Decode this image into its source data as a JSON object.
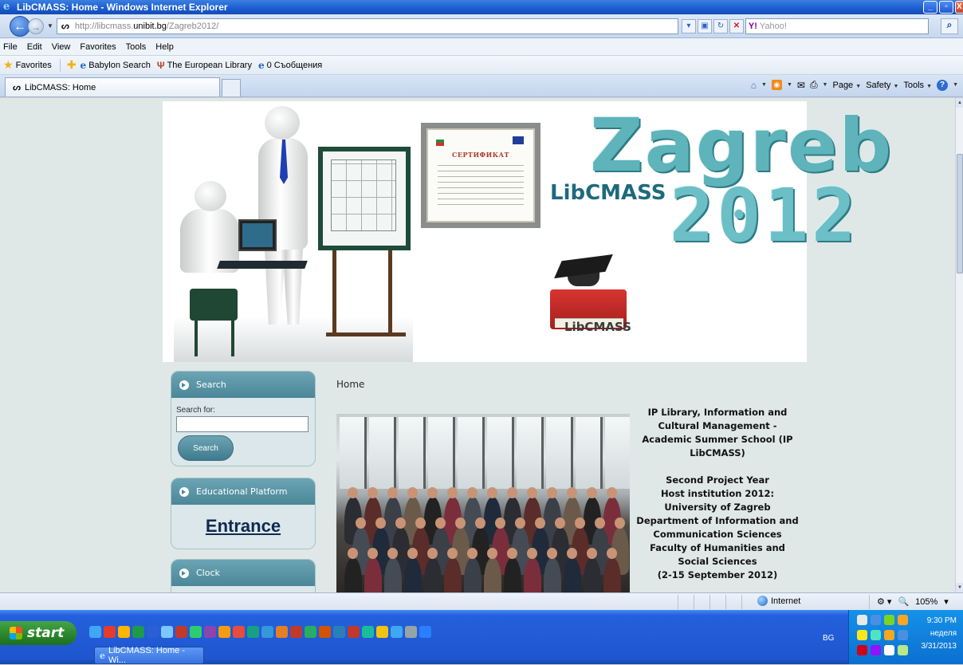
{
  "window": {
    "title": "LibCMASS: Home - Windows Internet Explorer",
    "minimize": "_",
    "maximize": "▫",
    "close": "X"
  },
  "address": {
    "url_prefix": "http://libcmass.",
    "url_domain": "unibit.bg",
    "url_path": "/Zagreb2012/",
    "search_placeholder": "Yahoo!",
    "search_logo": "Y!"
  },
  "menu": [
    "File",
    "Edit",
    "View",
    "Favorites",
    "Tools",
    "Help"
  ],
  "favorites": {
    "label": "Favorites",
    "items": [
      "Babylon Search",
      "The European Library",
      "0 Съобщения"
    ]
  },
  "tab": {
    "title": "LibCMASS: Home"
  },
  "commands": {
    "page": "Page",
    "safety": "Safety",
    "tools": "Tools"
  },
  "banner": {
    "certificate_title": "СЕРТИФИКАТ",
    "wordmark": "LibCMASS",
    "city": "Zagreb",
    "year": "2012",
    "logo_text": "LibCMASS"
  },
  "sidebar": {
    "search": {
      "title": "Search",
      "label": "Search for:",
      "button": "Search"
    },
    "edu": {
      "title": "Educational Platform",
      "link": "Entrance"
    },
    "clock": {
      "title": "Clock"
    }
  },
  "main": {
    "title": "Home",
    "info": [
      "IP Library, Information and Cultural Management - Academic Summer School (IP LibCMASS)",
      "",
      "Second Project Year",
      "Host institution 2012: University of Zagreb",
      "Department of Information and Communication Sciences",
      "Faculty of Humanities and Social Sciences",
      "(2-15 September 2012)"
    ]
  },
  "status": {
    "zone": "Internet",
    "zoom": "105%"
  },
  "taskbar": {
    "start": "start",
    "task": "LibCMASS: Home - Wi...",
    "lang": "BG",
    "time": "9:30 PM",
    "day": "неделя",
    "date": "3/31/2013"
  },
  "colors": {
    "accent": "#4a8798",
    "xp_blue": "#1f56cf",
    "start_green": "#2d8a2f",
    "page_bg": "#dfe8e6"
  }
}
